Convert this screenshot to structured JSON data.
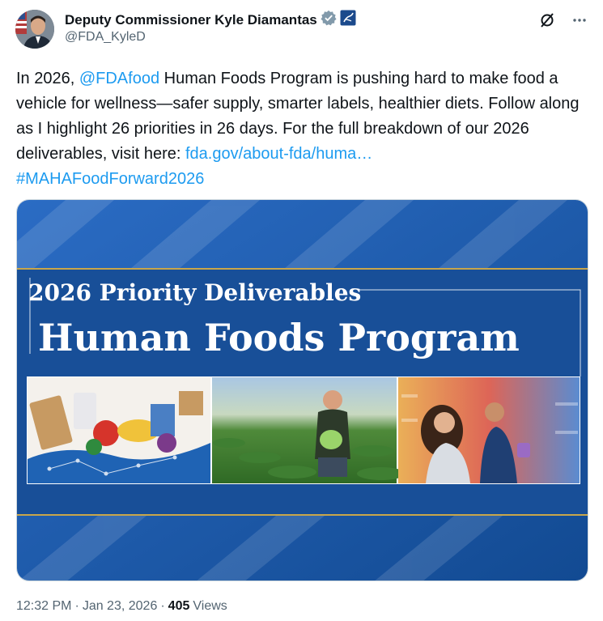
{
  "author": {
    "display_name": "Deputy Commissioner Kyle Diamantas",
    "handle": "@FDA_KyleD"
  },
  "icons": {
    "verified": "verified-badge-icon",
    "affiliate": "hhs-affiliate-badge-icon",
    "grok": "grok-icon",
    "more": "more-icon"
  },
  "tweet": {
    "part1": "In 2026, ",
    "mention": "@FDAfood",
    "part2": " Human Foods Program is pushing hard to make food a vehicle for wellness—safer supply, smarter labels, healthier diets. Follow along as I highlight 26 priorities in 26 days. For the full breakdown of our 2026 deliverables, visit here: ",
    "link": "fda.gov/about-fda/huma…",
    "hashtag": "#MAHAFoodForward2026"
  },
  "media": {
    "subtitle": "2026 Priority Deliverables",
    "title": "Human Foods Program"
  },
  "meta": {
    "time": "12:32 PM",
    "sep1": "·",
    "date": "Jan 23, 2026",
    "sep2": "·",
    "views_count": "405",
    "views_label": "Views"
  },
  "colors": {
    "link": "#1d9bf0",
    "banner_blue": "#1a5aa8",
    "gold": "#c9a64a"
  }
}
